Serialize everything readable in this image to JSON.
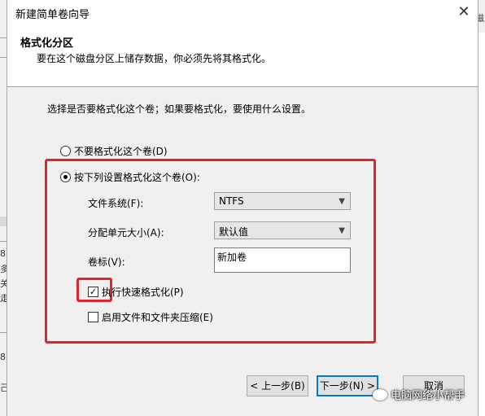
{
  "background_window": {
    "left_fragments": [
      "8",
      "多",
      "关",
      "走",
      "8",
      "己"
    ],
    "right_fragment": "磁"
  },
  "dialog": {
    "title": "新建简单卷向导",
    "close_glyph": "✕",
    "header": {
      "title": "格式化分区",
      "subtitle": "要在这个磁盘分区上储存数据，你必须先将其格式化。"
    },
    "intro": "选择是否要格式化这个卷；如果要格式化，要使用什么设置。",
    "radio_no_format": "不要格式化这个卷(D)",
    "radio_format": "按下列设置格式化这个卷(O):",
    "file_system": {
      "label": "文件系统(F):",
      "value": "NTFS"
    },
    "allocation_unit": {
      "label": "分配单元大小(A):",
      "value": "默认值"
    },
    "volume_label": {
      "label": "卷标(V):",
      "value": "新加卷"
    },
    "quick_format": {
      "label": "执行快速格式化(P)",
      "checked": true
    },
    "compression": {
      "label": "启用文件和文件夹压缩(E)",
      "checked": false
    },
    "buttons": {
      "back": "< 上一步(B)",
      "next": "下一步(N) >",
      "cancel": "取消"
    },
    "watermark": "电脑网络小帮手"
  }
}
